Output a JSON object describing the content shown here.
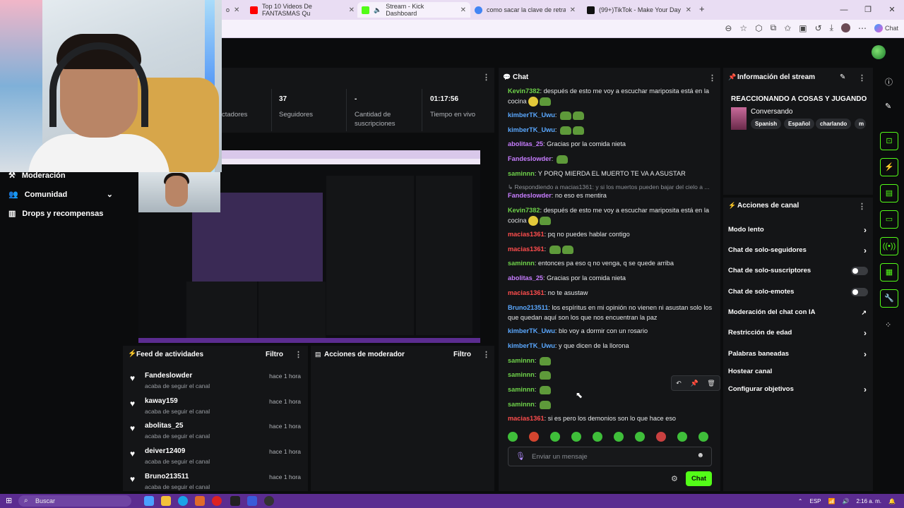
{
  "browser": {
    "tabs": [
      {
        "label": "Top 10 Videos De FANTASMAS Qu",
        "color": "#ff0000"
      },
      {
        "label": "Stream - Kick Dashboard",
        "color": "#53fc18"
      },
      {
        "label": "como sacar la clave de retransmisi",
        "color": "#4285f4"
      },
      {
        "label": "(99+)TikTok - Make Your Day",
        "color": "#111111"
      }
    ],
    "tab_partial": "o",
    "new_tab": "+",
    "copilot_label": "Chat"
  },
  "stats": [
    {
      "value": "",
      "label": "Espectadores",
      "visible_label": "ctadores"
    },
    {
      "value": "37",
      "label": "Seguidores"
    },
    {
      "value": "-",
      "label": "Cantidad de suscripciones"
    },
    {
      "value": "01:17:56",
      "label": "Tiempo en vivo"
    }
  ],
  "nav": {
    "items": [
      {
        "label": "Moderación",
        "icon": "hammer-icon"
      },
      {
        "label": "Comunidad",
        "icon": "users-icon"
      },
      {
        "label": "Drops y recompensas",
        "icon": "chart-icon"
      }
    ]
  },
  "feed": {
    "title": "Feed de actividades",
    "filter": "Filtro",
    "items": [
      {
        "name": "Fandeslowder",
        "action": "acaba de seguir el canal",
        "time": "hace 1 hora"
      },
      {
        "name": "kaway159",
        "action": "acaba de seguir el canal",
        "time": "hace 1 hora"
      },
      {
        "name": "abolitas_25",
        "action": "acaba de seguir el canal",
        "time": "hace 1 hora"
      },
      {
        "name": "deiver12409",
        "action": "acaba de seguir el canal",
        "time": "hace 1 hora"
      },
      {
        "name": "Bruno213511",
        "action": "acaba de seguir el canal",
        "time": "hace 1 hora"
      }
    ]
  },
  "mod_actions": {
    "title": "Acciones de moderador",
    "filter": "Filtro"
  },
  "chat": {
    "title": "Chat",
    "messages": [
      {
        "user": "Kevin7382",
        "color": "#6fd34a",
        "text": "después de esto me voy a escuchar mariposita está en la cocina"
      },
      {
        "user": "kimberTK_Uwu",
        "color": "#5aa8ff",
        "text": ""
      },
      {
        "user": "kimberTK_Uwu",
        "color": "#5aa8ff",
        "text": ""
      },
      {
        "user": "abolitas_25",
        "color": "#c77dff",
        "text": "Gracias por la comida nieta"
      },
      {
        "user": "Fandeslowder",
        "color": "#c77dff",
        "text": ""
      },
      {
        "user": "saminnn",
        "color": "#6fd34a",
        "text": "Y PORQ MIERDA EL MUERTO TE VA A ASUSTAR"
      },
      {
        "user": "Fandeslowder",
        "color": "#c77dff",
        "text": "no eso es mentira"
      },
      {
        "user": "Kevin7382",
        "color": "#6fd34a",
        "text": "después de esto me voy a escuchar mariposita está en la cocina"
      },
      {
        "user": "macias1361",
        "color": "#ff4d4d",
        "text": "pq no puedes hablar contigo"
      },
      {
        "user": "macias1361",
        "color": "#ff4d4d",
        "text": ""
      },
      {
        "user": "saminnn",
        "color": "#6fd34a",
        "text": "entonces pa eso q no venga, q se quede arriba"
      },
      {
        "user": "abolitas_25",
        "color": "#c77dff",
        "text": "Gracias por la comida nieta"
      },
      {
        "user": "macias1361",
        "color": "#ff4d4d",
        "text": "no te asustaw"
      },
      {
        "user": "Bruno213511",
        "color": "#5aa8ff",
        "text": "los espíritus en mi opinión no vienen ni asustan solo los que quedan aquí son los que nos encuentran la paz"
      },
      {
        "user": "kimberTK_Uwu",
        "color": "#5aa8ff",
        "text": "blo voy a dormir con un rosario"
      },
      {
        "user": "kimberTK_Uwu",
        "color": "#5aa8ff",
        "text": "y que dicen de la llorona"
      },
      {
        "user": "saminnn",
        "color": "#6fd34a",
        "text": ""
      },
      {
        "user": "saminnn",
        "color": "#6fd34a",
        "text": ""
      },
      {
        "user": "saminnn",
        "color": "#6fd34a",
        "text": ""
      },
      {
        "user": "saminnn",
        "color": "#6fd34a",
        "text": ""
      },
      {
        "user": "macias1361",
        "color": "#ff4d4d",
        "text": "si es pero los demonios son lo que hace eso"
      }
    ],
    "reply_note": "Respondiendo a macias1361: y si los muertos pueden bajar del cielo a ...",
    "input_placeholder": "Enviar un mensaje",
    "send_label": "Chat"
  },
  "stream_info": {
    "title": "Información del stream",
    "stream_title": "REACCIONANDO A COSAS Y JUGANDO",
    "category": "Conversando",
    "tags": [
      "Spanish",
      "Español",
      "charlando",
      "m"
    ]
  },
  "channel_actions": {
    "title": "Acciones de canal",
    "items": [
      {
        "label": "Modo lento",
        "control": "chevron"
      },
      {
        "label": "Chat de solo-seguidores",
        "control": "chevron"
      },
      {
        "label": "Chat de solo-suscriptores",
        "control": "toggle",
        "on": false
      },
      {
        "label": "Chat de solo-emotes",
        "control": "toggle",
        "on": false
      },
      {
        "label": "Moderación del chat con IA",
        "control": "external"
      },
      {
        "label": "Restricción de edad",
        "control": "chevron"
      },
      {
        "label": "Palabras baneadas",
        "control": "chevron"
      },
      {
        "label": "Hostear canal",
        "control": "none"
      },
      {
        "label": "Configurar objetivos",
        "control": "chevron"
      }
    ]
  },
  "taskbar": {
    "search_placeholder": "Buscar",
    "lang": "ESP",
    "time": "2:16 a. m."
  },
  "colors": {
    "accent": "#53fc18",
    "panel": "#141517",
    "bg": "#0b0c0d"
  }
}
